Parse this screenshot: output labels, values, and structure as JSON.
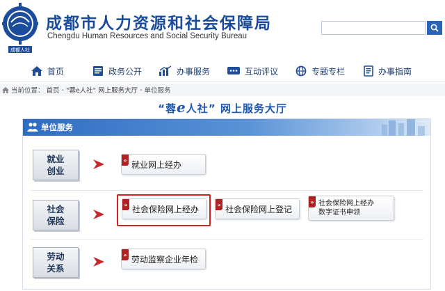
{
  "header": {
    "title_cn": "成都市人力资源和社会保障局",
    "title_en": "Chengdu Human Resources and Social Security Bureau",
    "logo_text": "成都人社",
    "search_placeholder": ""
  },
  "nav": {
    "items": [
      {
        "label": "首页",
        "icon": "home-icon"
      },
      {
        "label": "政务公开",
        "icon": "document-icon"
      },
      {
        "label": "办事服务",
        "icon": "chart-icon"
      },
      {
        "label": "互动评议",
        "icon": "chat-icon"
      },
      {
        "label": "专题专栏",
        "icon": "globe-icon"
      },
      {
        "label": "办事指南",
        "icon": "guide-icon"
      }
    ]
  },
  "breadcrumb": {
    "prefix": "当前位置：",
    "items": [
      "首页",
      "\"蓉e人社\" 网上服务大厅",
      "单位服务"
    ],
    "separator": "-"
  },
  "hall": {
    "title_open": "“蓉",
    "title_e": "e",
    "title_close": "人社” 网上服务大厅"
  },
  "panel": {
    "title": "单位服务",
    "categories": [
      {
        "label_line1": "就业",
        "label_line2": "创业",
        "services": [
          {
            "label": "就业网上经办"
          }
        ]
      },
      {
        "label_line1": "社会",
        "label_line2": "保险",
        "services": [
          {
            "label": "社会保险网上经办",
            "highlighted": true
          },
          {
            "label": "社会保险网上登记"
          },
          {
            "label_line1": "社会保险网上经办",
            "label_line2": "数字证书申领"
          }
        ]
      },
      {
        "label_line1": "劳动",
        "label_line2": "关系",
        "services": [
          {
            "label": "劳动监察企业年检"
          }
        ]
      }
    ]
  },
  "colors": {
    "brand_blue": "#1a4b9a",
    "nav_text": "#1f3f73",
    "arrow_red": "#c9252a",
    "highlight_red": "#d52020"
  }
}
